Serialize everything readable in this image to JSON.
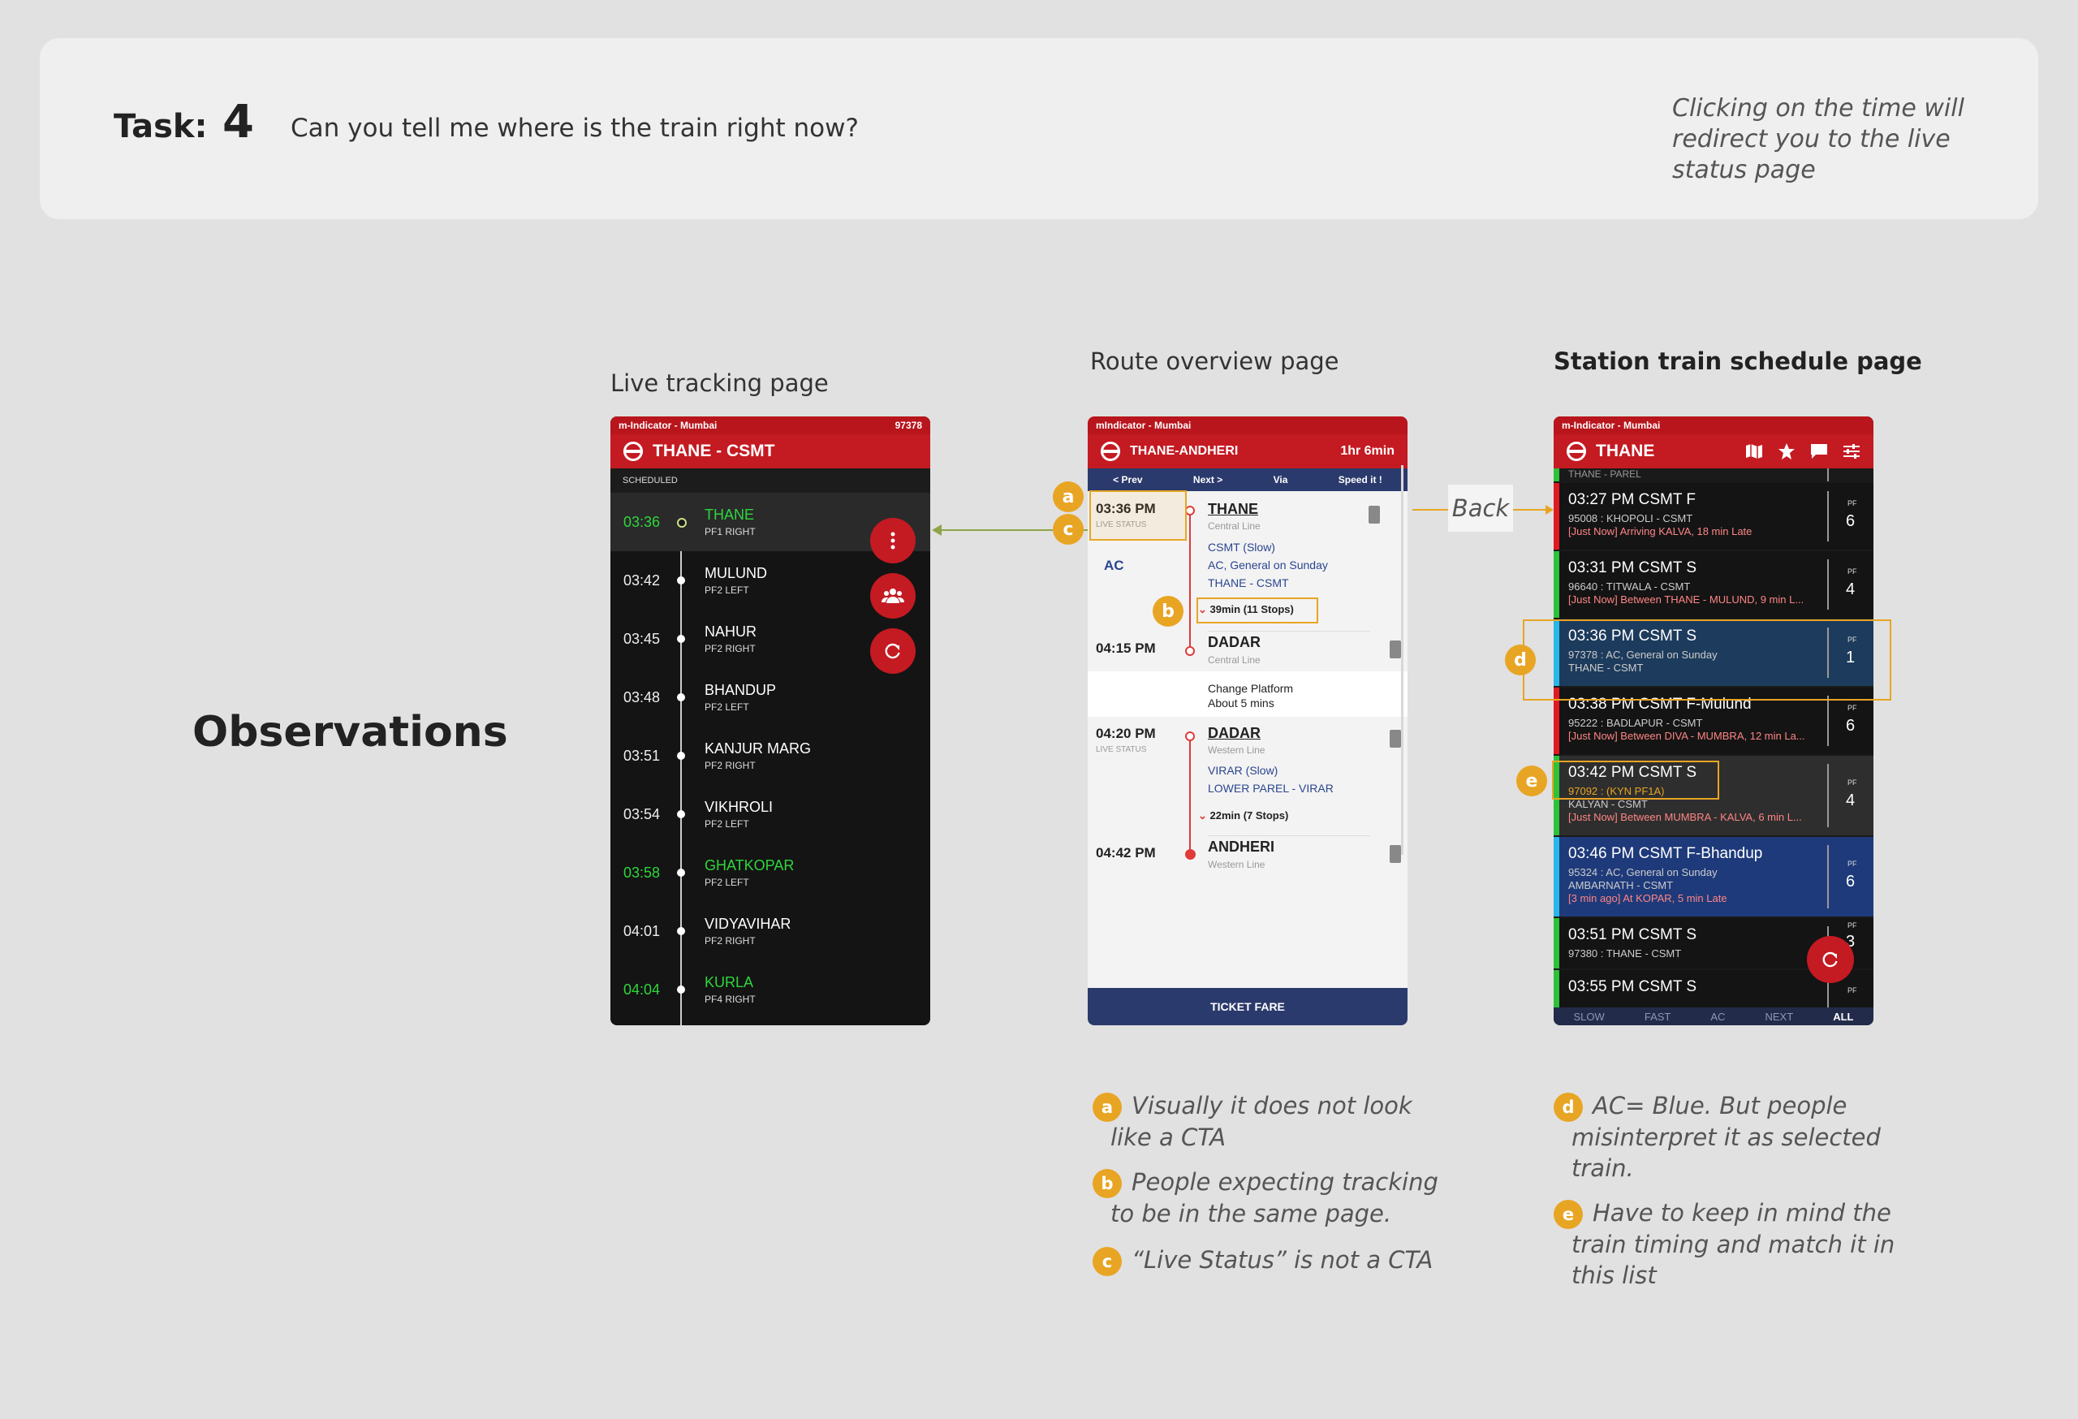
{
  "task": {
    "label": "Task:",
    "number": "4",
    "question": "Can you tell me where is the train right now?",
    "note": "Clicking on the time will redirect you to the live status page"
  },
  "observations_title": "Observations",
  "sections": {
    "live": "Live tracking page",
    "route": "Route overview page",
    "schedule": "Station train schedule page"
  },
  "back_label": "Back",
  "live_page": {
    "app": "m-Indicator - Mumbai",
    "train_no": "97378",
    "title": "THANE - CSMT",
    "scheduled": "SCHEDULED",
    "stations": [
      {
        "time": "03:36",
        "name": "THANE",
        "pf": "PF1 RIGHT"
      },
      {
        "time": "03:42",
        "name": "MULUND",
        "pf": "PF2 LEFT"
      },
      {
        "time": "03:45",
        "name": "NAHUR",
        "pf": "PF2 RIGHT"
      },
      {
        "time": "03:48",
        "name": "BHANDUP",
        "pf": "PF2 LEFT"
      },
      {
        "time": "03:51",
        "name": "KANJUR MARG",
        "pf": "PF2 RIGHT"
      },
      {
        "time": "03:54",
        "name": "VIKHROLI",
        "pf": "PF2 LEFT"
      },
      {
        "time": "03:58",
        "name": "GHATKOPAR",
        "pf": "PF2 LEFT"
      },
      {
        "time": "04:01",
        "name": "VIDYAVIHAR",
        "pf": "PF2 RIGHT"
      },
      {
        "time": "04:04",
        "name": "KURLA",
        "pf": "PF4 RIGHT"
      }
    ],
    "fab_icons": [
      "more-vert-icon",
      "people-icon",
      "refresh-icon"
    ]
  },
  "route_page": {
    "app": "mIndicator - Mumbai",
    "title": "THANE-ANDHERI",
    "duration": "1hr 6min",
    "nav": [
      "< Prev",
      "Next >",
      "Via",
      "Speed it !"
    ],
    "ac": "AC",
    "live_status": "LIVE STATUS",
    "leg1": {
      "time": "03:36 PM",
      "station": "THANE",
      "line": "Central Line",
      "desc1": "CSMT (Slow)",
      "desc2": "AC, General on Sunday",
      "desc3": "THANE - CSMT",
      "stops": "39min (11 Stops)"
    },
    "leg1_end": {
      "time": "04:15 PM",
      "station": "DADAR",
      "line": "Central Line"
    },
    "change1": "Change Platform",
    "change2": "About 5 mins",
    "leg2": {
      "time": "04:20 PM",
      "station": "DADAR",
      "line": "Western Line",
      "desc1": "VIRAR (Slow)",
      "desc2": "LOWER PAREL - VIRAR",
      "stops": "22min (7 Stops)"
    },
    "leg2_end": {
      "time": "04:42 PM",
      "station": "ANDHERI",
      "line": "Western Line"
    },
    "ticket": "TICKET FARE"
  },
  "schedule_page": {
    "app": "m-Indicator - Mumbai",
    "title": "THANE",
    "clipped": "THANE - PAREL",
    "pf_label": "PF",
    "rows": [
      {
        "t": "03:27 PM  CSMT  F",
        "l1": "95008 : KHOPOLI - CSMT",
        "l2": "[Just Now] Arriving KALVA, 18 min Late",
        "l3": "",
        "pf": "6",
        "bar": "#e01a22",
        "bg": "#141414"
      },
      {
        "t": "03:31 PM  CSMT  S",
        "l1": "96640 : TITWALA - CSMT",
        "l2": "[Just Now] Between THANE - MULUND, 9 min L...",
        "l3": "",
        "pf": "4",
        "bar": "#2ec23a",
        "bg": "#141414"
      },
      {
        "t": "03:36 PM  CSMT  S",
        "l1": "97378 : AC, General on Sunday",
        "l2": "",
        "l3": "THANE - CSMT",
        "pf": "1",
        "bar": "#29b6e8",
        "bg": "#1d3b5c"
      },
      {
        "t": "03:38 PM  CSMT   F-Mulund",
        "l1": "95222 : BADLAPUR - CSMT",
        "l2": "[Just Now] Between DIVA - MUMBRA, 12 min La...",
        "l3": "",
        "pf": "6",
        "bar": "#e01a22",
        "bg": "#141414"
      },
      {
        "t": "03:42 PM  CSMT  S",
        "l1": "97092 : (KYN PF1A)",
        "l2": "[Just Now] Between MUMBRA - KALVA, 6 min L...",
        "l3": "KALYAN - CSMT",
        "pf": "4",
        "bar": "#2ec23a",
        "bg": "#2e2e2e"
      },
      {
        "t": "03:46 PM  CSMT   F-Bhandup",
        "l1": "95324 : AC, General on Sunday",
        "l2": "[3 min ago] At KOPAR, 5 min Late",
        "l3": "AMBARNATH - CSMT",
        "pf": "6",
        "bar": "#29b6e8",
        "bg": "#1e3a7a"
      },
      {
        "t": "03:51 PM  CSMT  S",
        "l1": "97380 : THANE - CSMT",
        "l2": "",
        "l3": "",
        "pf": "3",
        "bar": "#2ec23a",
        "bg": "#141414"
      },
      {
        "t": "03:55 PM  CSMT  S",
        "l1": "",
        "l2": "",
        "l3": "",
        "pf": "",
        "bar": "#2ec23a",
        "bg": "#141414"
      }
    ],
    "tabs": [
      "SLOW",
      "FAST",
      "AC",
      "NEXT",
      "ALL"
    ]
  },
  "annotations": {
    "a": "Visually it does not look like a CTA",
    "b": "People expecting tracking to be in the same page.",
    "c": "“Live Status” is not a CTA",
    "d": "AC= Blue. But people misinterpret it as selected train.",
    "e": "Have to keep in mind the train timing and match it in this list"
  },
  "letters": [
    "a",
    "b",
    "c",
    "d",
    "e"
  ],
  "colors": {
    "accent": "#e8a524",
    "brand_red": "#c41a22",
    "navy": "#2b3a6c",
    "live_green": "#2ed63c"
  }
}
